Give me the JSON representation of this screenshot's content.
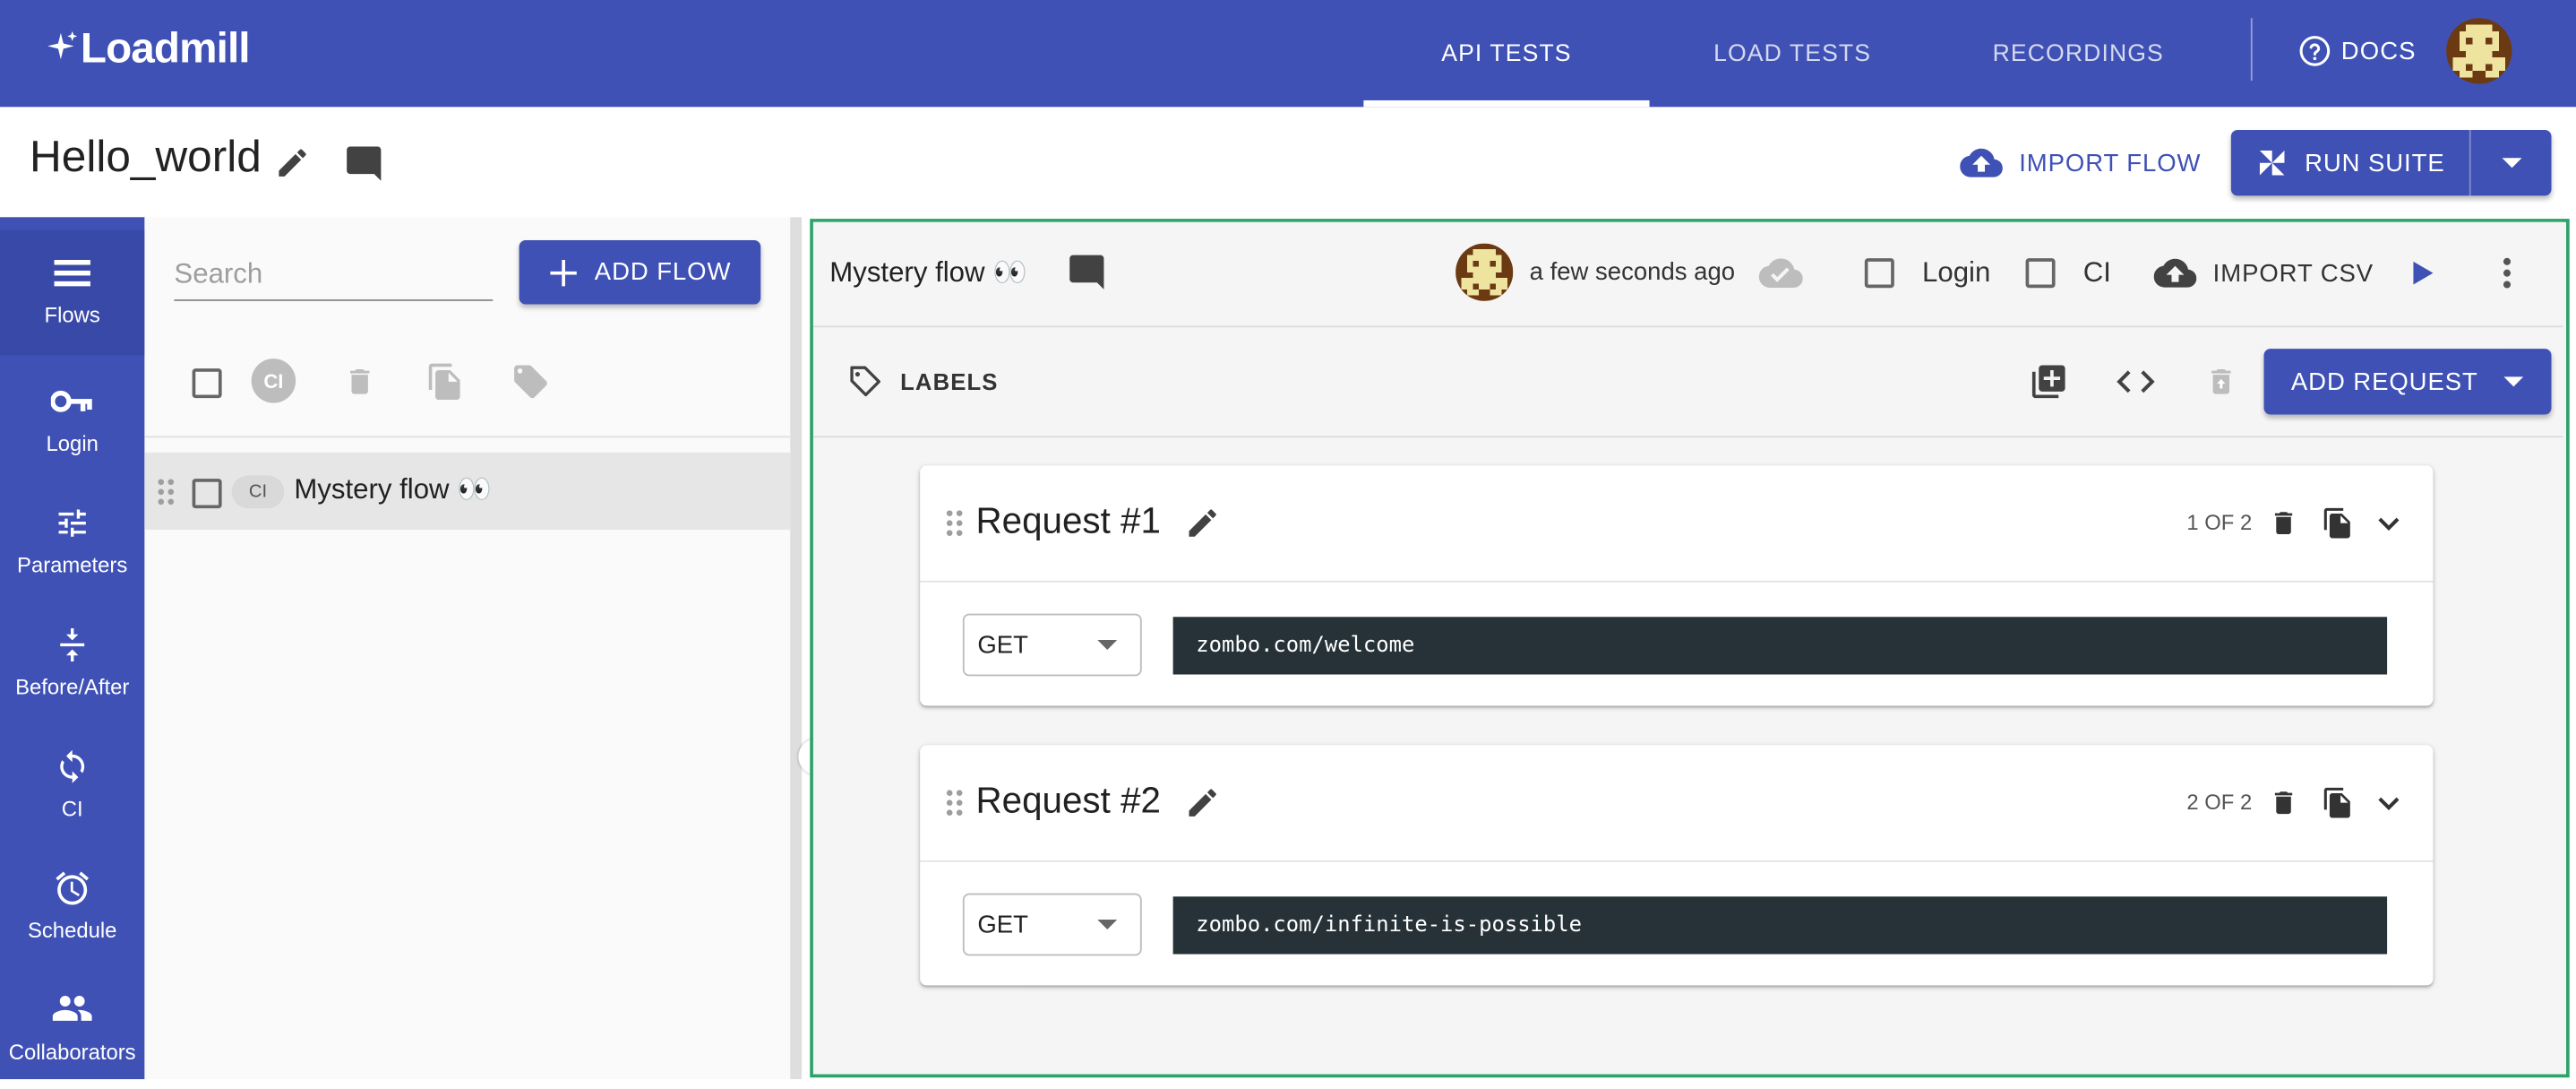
{
  "app": {
    "logo_text": "Loadmill",
    "nav_tabs": [
      {
        "label": "API TESTS",
        "active": true
      },
      {
        "label": "LOAD TESTS",
        "active": false
      },
      {
        "label": "RECORDINGS",
        "active": false
      }
    ],
    "docs_label": "DOCS",
    "accent_color": "#3f51b5"
  },
  "header": {
    "suite_title": "Hello_world",
    "import_flow_label": "IMPORT FLOW",
    "run_suite_label": "RUN SUITE"
  },
  "leftnav": {
    "items": [
      {
        "label": "Flows",
        "icon": "list-icon",
        "active": true
      },
      {
        "label": "Login",
        "icon": "key-icon",
        "active": false
      },
      {
        "label": "Parameters",
        "icon": "tune-icon",
        "active": false
      },
      {
        "label": "Before/After",
        "icon": "vertical-align-center-icon",
        "active": false
      },
      {
        "label": "CI",
        "icon": "sync-icon",
        "active": false
      },
      {
        "label": "Schedule",
        "icon": "alarm-icon",
        "active": false
      },
      {
        "label": "Collaborators",
        "icon": "people-icon",
        "active": false
      }
    ]
  },
  "flows_panel": {
    "search_placeholder": "Search",
    "add_flow_label": "ADD FLOW",
    "ci_circle_label": "CI",
    "flows": [
      {
        "name": "Mystery flow 👀",
        "ci_chip": "CI"
      }
    ]
  },
  "editor": {
    "flow_title": "Mystery flow 👀",
    "last_saved": "a few seconds ago",
    "login_label": "Login",
    "ci_label": "CI",
    "import_csv_label": "IMPORT CSV",
    "labels_label": "LABELS",
    "add_request_label": "ADD REQUEST",
    "frame_color": "#2ca36a",
    "requests": [
      {
        "title": "Request #1",
        "count": "1 OF 2",
        "method": "GET",
        "url": "zombo.com/welcome"
      },
      {
        "title": "Request #2",
        "count": "2 OF 2",
        "method": "GET",
        "url": "zombo.com/infinite-is-possible"
      }
    ]
  }
}
